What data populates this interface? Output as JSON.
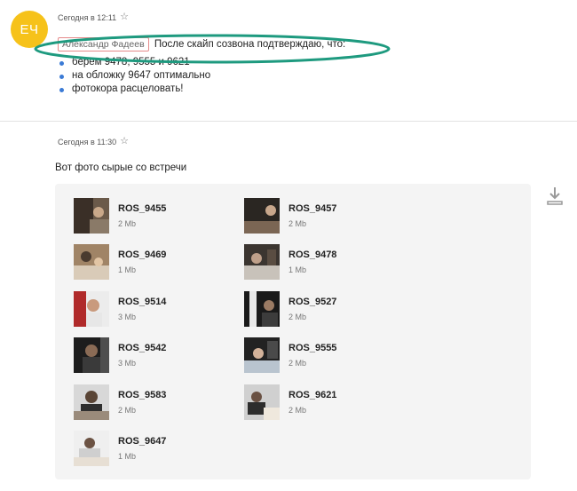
{
  "message1": {
    "avatar_initials": "ЕЧ",
    "timestamp": "Сегодня в 12:11",
    "mention": "Александр Фадеев",
    "headline": "После скайп созвона подтверждаю, что:",
    "points": [
      "берем 9478, 9555 и 9621",
      "на обложку 9647 оптимально",
      "фотокора расцеловать!"
    ]
  },
  "message2": {
    "timestamp": "Сегодня в 11:30",
    "text": "Вот фото сырые со встречи",
    "attachments": [
      {
        "name": "ROS_9455",
        "size": "2 Mb"
      },
      {
        "name": "ROS_9457",
        "size": "2 Mb"
      },
      {
        "name": "ROS_9469",
        "size": "1 Mb"
      },
      {
        "name": "ROS_9478",
        "size": "1 Mb"
      },
      {
        "name": "ROS_9514",
        "size": "3 Mb"
      },
      {
        "name": "ROS_9527",
        "size": "2 Mb"
      },
      {
        "name": "ROS_9542",
        "size": "3 Mb"
      },
      {
        "name": "ROS_9555",
        "size": "2 Mb"
      },
      {
        "name": "ROS_9583",
        "size": "2 Mb"
      },
      {
        "name": "ROS_9621",
        "size": "2 Mb"
      },
      {
        "name": "ROS_9647",
        "size": "1 Mb"
      }
    ]
  },
  "colors": {
    "avatar": "#f6c21a",
    "highlight_ellipse": "#1e9a7f",
    "bullet": "#3b7bd6",
    "mention_border": "#e58a8a"
  },
  "icons": {
    "star": "star-icon",
    "download": "download-icon"
  }
}
